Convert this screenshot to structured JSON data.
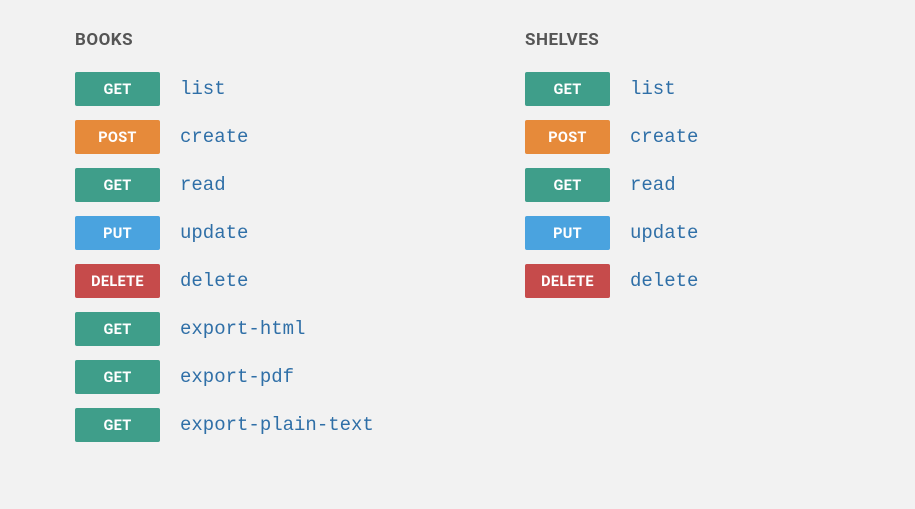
{
  "methodColors": {
    "GET": "method-get",
    "POST": "method-post",
    "PUT": "method-put",
    "DELETE": "method-delete"
  },
  "sections": [
    {
      "title": "BOOKS",
      "slug": "books",
      "endpoints": [
        {
          "method": "GET",
          "name": "list"
        },
        {
          "method": "POST",
          "name": "create"
        },
        {
          "method": "GET",
          "name": "read"
        },
        {
          "method": "PUT",
          "name": "update"
        },
        {
          "method": "DELETE",
          "name": "delete"
        },
        {
          "method": "GET",
          "name": "export-html"
        },
        {
          "method": "GET",
          "name": "export-pdf"
        },
        {
          "method": "GET",
          "name": "export-plain-text"
        }
      ]
    },
    {
      "title": "SHELVES",
      "slug": "shelves",
      "endpoints": [
        {
          "method": "GET",
          "name": "list"
        },
        {
          "method": "POST",
          "name": "create"
        },
        {
          "method": "GET",
          "name": "read"
        },
        {
          "method": "PUT",
          "name": "update"
        },
        {
          "method": "DELETE",
          "name": "delete"
        }
      ]
    }
  ]
}
